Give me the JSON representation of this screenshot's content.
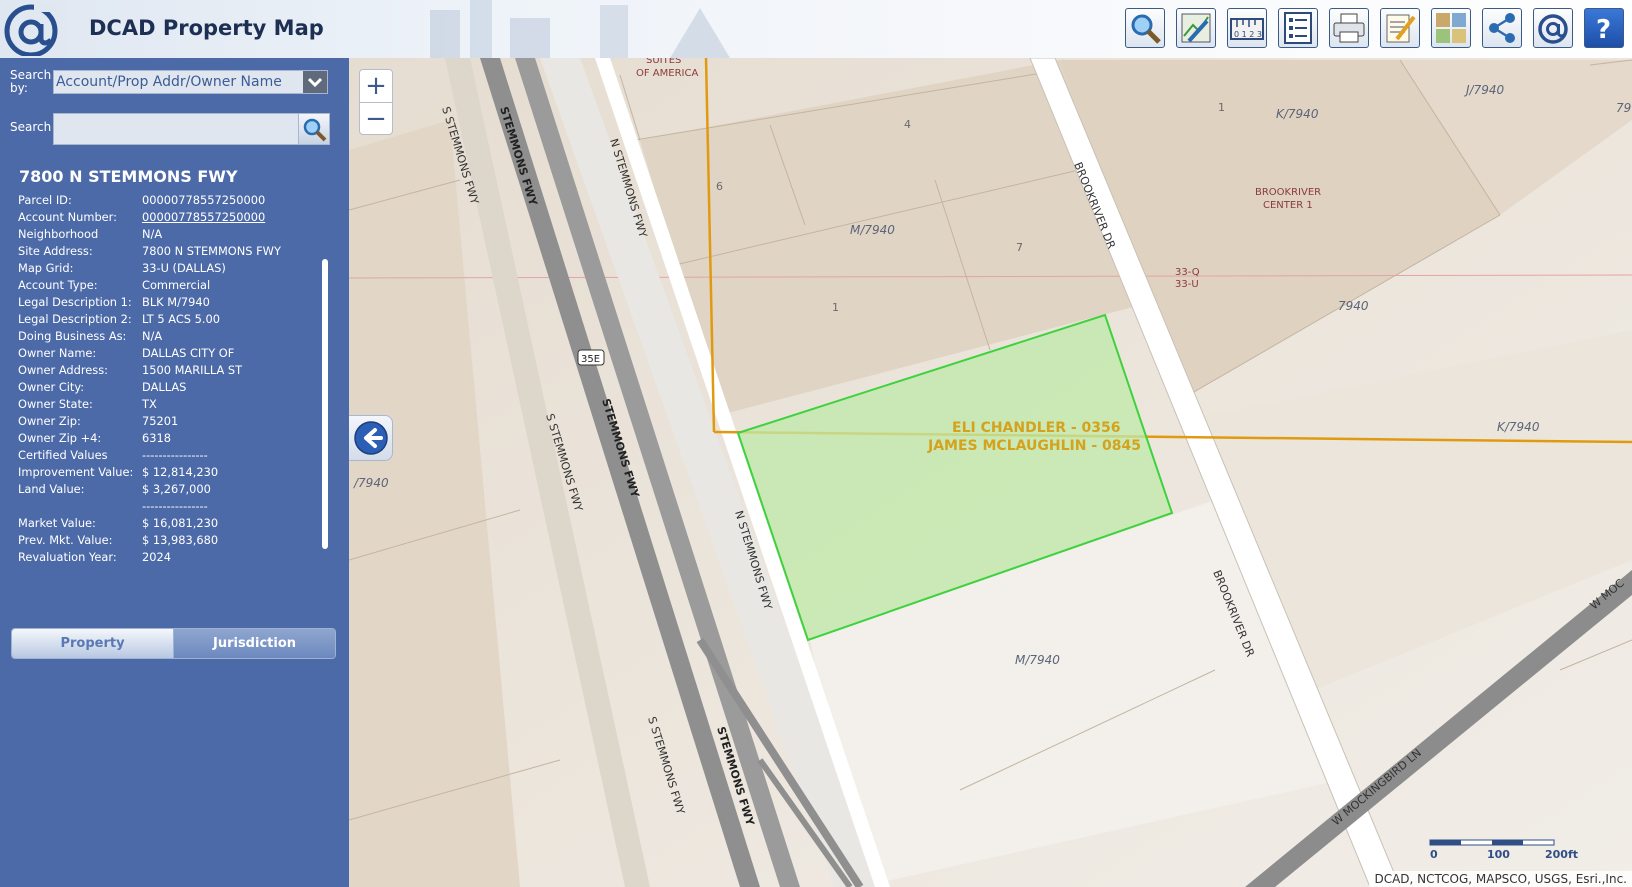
{
  "header": {
    "title": "DCAD Property Map",
    "toolbar": [
      {
        "name": "search-tool",
        "icon": "magnifier-icon"
      },
      {
        "name": "draw-tool",
        "icon": "pencil-map-icon"
      },
      {
        "name": "measure-tool",
        "icon": "ruler-icon"
      },
      {
        "name": "layers-list-tool",
        "icon": "list-icon"
      },
      {
        "name": "print-tool",
        "icon": "printer-icon"
      },
      {
        "name": "edit-tool",
        "icon": "notepad-icon"
      },
      {
        "name": "basemap-tool",
        "icon": "basemap-grid-icon"
      },
      {
        "name": "share-tool",
        "icon": "share-icon"
      },
      {
        "name": "dcad-home-tool",
        "icon": "at-logo-icon"
      },
      {
        "name": "help-tool",
        "icon": "question-icon"
      }
    ]
  },
  "search": {
    "by_label": "Search by:",
    "by_value": "Account/Prop Addr/Owner Name",
    "label": "Search",
    "value": ""
  },
  "property": {
    "title": "7800 N STEMMONS FWY",
    "rows": [
      {
        "k": "Parcel ID:",
        "v": "00000778557250000"
      },
      {
        "k": "Account Number:",
        "v": "00000778557250000"
      },
      {
        "k": "Neighborhood",
        "v": "N/A"
      },
      {
        "k": "Site Address:",
        "v": "7800 N STEMMONS FWY"
      },
      {
        "k": "Map Grid:",
        "v": "33-U (DALLAS)"
      },
      {
        "k": "Account Type:",
        "v": "Commercial"
      },
      {
        "k": "Legal Description 1:",
        "v": "BLK M/7940"
      },
      {
        "k": "Legal Description 2:",
        "v": "LT 5 ACS 5.00"
      },
      {
        "k": "Doing Business As:",
        "v": "N/A"
      },
      {
        "k": "Owner Name:",
        "v": "DALLAS CITY OF"
      },
      {
        "k": "Owner Address:",
        "v": "1500 MARILLA ST"
      },
      {
        "k": "Owner City:",
        "v": "DALLAS"
      },
      {
        "k": "Owner State:",
        "v": "TX"
      },
      {
        "k": "Owner Zip:",
        "v": "75201"
      },
      {
        "k": "Owner Zip +4:",
        "v": "6318"
      },
      {
        "k": "Certified Values",
        "v": "----------------"
      },
      {
        "k": "Improvement Value:",
        "v": "$ 12,814,230"
      },
      {
        "k": "Land Value:",
        "v": "$ 3,267,000"
      },
      {
        "k": "",
        "v": "----------------"
      },
      {
        "k": "Market Value:",
        "v": "$ 16,081,230"
      },
      {
        "k": "Prev. Mkt. Value:",
        "v": "$ 13,983,680"
      },
      {
        "k": "Revaluation Year:",
        "v": "2024"
      }
    ]
  },
  "tabs": {
    "property": "Property",
    "jurisdiction": "Jurisdiction"
  },
  "map": {
    "zoom_in": "+",
    "zoom_out": "−",
    "attribution": "DCAD, NCTCOG, MAPSCO, USGS, Esri.,Inc.",
    "scale": {
      "t0": "0",
      "t1": "100",
      "t2": "200ft"
    },
    "parcel_labels": [
      "ELI CHANDLER - 0356",
      "JAMES MCLAUGHLIN - 0845"
    ],
    "street_labels": {
      "s_stemmons_1": "S STEMMONS FWY",
      "s_stemmons_2": "S STEMMONS FWY",
      "s_stemmons_3": "S STEMMONS FWY",
      "stemmons_1": "STEMMONS FWY",
      "stemmons_2": "STEMMONS FWY",
      "stemmons_3": "STEMMONS FWY",
      "n_stemmons_1": "N STEMMONS FWY",
      "n_stemmons_2": "N STEMMONS FWY",
      "brookriver_1": "BROOKRIVER DR",
      "brookriver_2": "BROOKRIVER DR",
      "mockingbird": "W MOCKINGBIRD LN",
      "w_mock": "W MOC",
      "hwy_shield": "35E"
    },
    "block_labels": {
      "m7940_a": "M/7940",
      "m7940_b": "M/7940",
      "k7940_a": "K/7940",
      "k7940_b": "K/7940",
      "j7940": "J/7940",
      "n7940": "7940",
      "left_7940": "/7940",
      "edge_79": "79",
      "suites": "SUITES",
      "of_america": "OF AMERICA",
      "brookriver_center_1": "BROOKRIVER",
      "brookriver_center_2": "CENTER 1",
      "grid_q": "33-Q",
      "grid_u": "33-U",
      "lot1": "1",
      "lot4": "4",
      "lot6": "6",
      "lot7": "7",
      "lot1b": "1"
    }
  }
}
